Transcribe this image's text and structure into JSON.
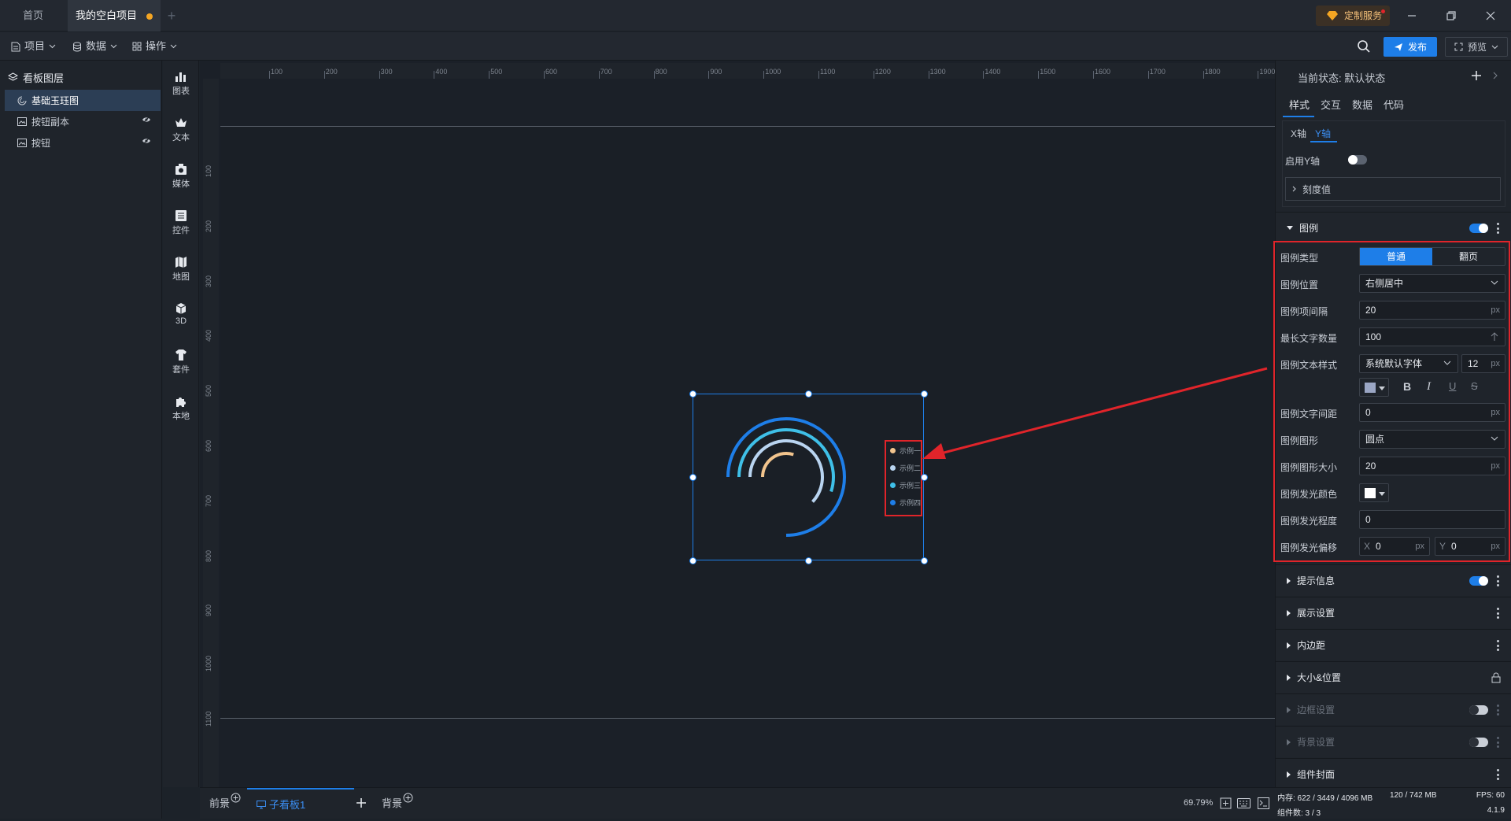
{
  "titlebar": {
    "tabs": [
      {
        "label": "首页"
      },
      {
        "label": "我的空白项目"
      }
    ],
    "custom_service": "定制服务"
  },
  "toolbar": {
    "menus": [
      {
        "label": "项目"
      },
      {
        "label": "数据"
      },
      {
        "label": "操作"
      }
    ],
    "publish": "发布",
    "preview": "预览"
  },
  "layers": {
    "title": "看板图层",
    "items": [
      {
        "label": "基础玉珏图"
      },
      {
        "label": "按钮副本"
      },
      {
        "label": "按钮"
      }
    ]
  },
  "components": [
    {
      "label": "图表",
      "icon": "chart-icon"
    },
    {
      "label": "文本",
      "icon": "text-icon"
    },
    {
      "label": "媒体",
      "icon": "media-icon"
    },
    {
      "label": "控件",
      "icon": "control-icon"
    },
    {
      "label": "地图",
      "icon": "map-icon"
    },
    {
      "label": "3D",
      "icon": "cube-icon"
    },
    {
      "label": "套件",
      "icon": "kit-icon"
    },
    {
      "label": "本地",
      "icon": "puzzle-icon"
    }
  ],
  "ruler": {
    "top": [
      "100",
      "200",
      "300",
      "400",
      "500",
      "600",
      "700",
      "800",
      "900",
      "1000",
      "1100",
      "1200",
      "1300",
      "1400",
      "1500",
      "1600",
      "1700",
      "1800",
      "1900"
    ],
    "left": [
      "100",
      "200",
      "300",
      "400",
      "500",
      "600",
      "700",
      "800",
      "900",
      "1000",
      "1100"
    ]
  },
  "widget": {
    "legend": [
      {
        "label": "示例一",
        "color": "#f2c48d"
      },
      {
        "label": "示例二",
        "color": "#b9d4f0"
      },
      {
        "label": "示例三",
        "color": "#3fc0e8"
      },
      {
        "label": "示例四",
        "color": "#1e7ee8"
      }
    ],
    "rings": [
      {
        "color": "#1e7ee8",
        "fraction": 0.75
      },
      {
        "color": "#3fc0e8",
        "fraction": 0.55
      },
      {
        "color": "#b9d4f0",
        "fraction": 0.62
      },
      {
        "color": "#f2c48d",
        "fraction": 0.3
      }
    ]
  },
  "bottombar": {
    "tabs": [
      {
        "label": "前景"
      },
      {
        "label": "子看板1"
      },
      {
        "label": "背景"
      }
    ],
    "zoom": "69.79%"
  },
  "rpanel": {
    "state_label": "当前状态:",
    "state_value": "默认状态",
    "tabs": [
      {
        "label": "样式"
      },
      {
        "label": "交互"
      },
      {
        "label": "数据"
      },
      {
        "label": "代码"
      }
    ],
    "axis_tabs": [
      {
        "label": "X轴"
      },
      {
        "label": "Y轴"
      }
    ],
    "enable_y": "启用Y轴",
    "tick_value": "刻度值",
    "legend_section": "图例",
    "legend_type_label": "图例类型",
    "legend_type_options": [
      "普通",
      "翻页"
    ],
    "legend_position_label": "图例位置",
    "legend_position_value": "右侧居中",
    "legend_gap_label": "图例项间隔",
    "legend_gap_value": "20",
    "max_chars_label": "最长文字数量",
    "max_chars_value": "100",
    "text_style_label": "图例文本样式",
    "font_value": "系统默认字体",
    "font_size_value": "12",
    "letter_spacing_label": "图例文字间距",
    "letter_spacing_value": "0",
    "shape_label": "图例图形",
    "shape_value": "圆点",
    "shape_size_label": "图例图形大小",
    "shape_size_value": "20",
    "glow_color_label": "图例发光颜色",
    "glow_level_label": "图例发光程度",
    "glow_level_value": "0",
    "glow_offset_label": "图例发光偏移",
    "glow_offset_x": "0",
    "glow_offset_y": "0",
    "unit": "px",
    "x": "X",
    "y": "Y",
    "sections": [
      {
        "label": "提示信息"
      },
      {
        "label": "展示设置"
      },
      {
        "label": "内边距"
      },
      {
        "label": "大小&位置"
      },
      {
        "label": "边框设置"
      },
      {
        "label": "背景设置"
      },
      {
        "label": "组件封面"
      }
    ],
    "status": {
      "memory": "内存: 622 / 3449 / 4096 MB",
      "memory2": "120 / 742 MB",
      "fps": "FPS: 60",
      "count": "组件数: 3 / 3",
      "version": "4.1.9"
    }
  },
  "colors": {
    "accent": "#1e7ee8",
    "highlight": "#e0242a"
  }
}
